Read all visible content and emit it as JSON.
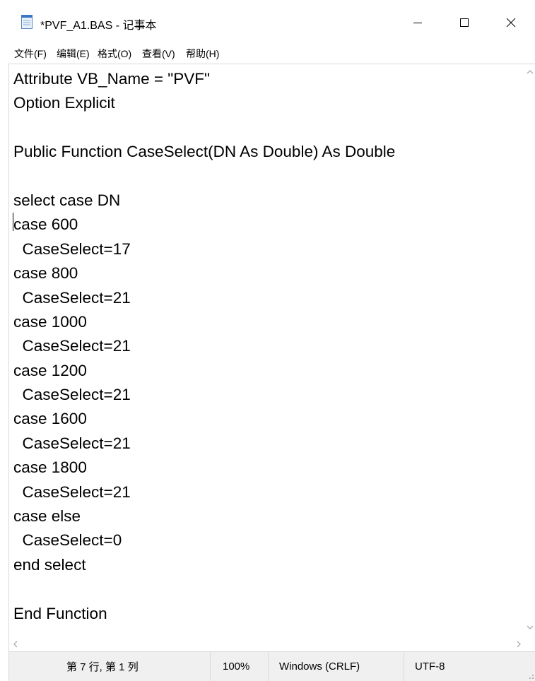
{
  "window": {
    "title": "*PVF_A1.BAS - 记事本",
    "controls": {
      "minimize": "minimize-icon",
      "maximize": "maximize-icon",
      "close": "close-icon"
    }
  },
  "menu": {
    "items": [
      {
        "label": "文件(F)"
      },
      {
        "label": "编辑(E)"
      },
      {
        "label": "格式(O)"
      },
      {
        "label": "查看(V)"
      },
      {
        "label": "帮助(H)"
      }
    ]
  },
  "editor": {
    "lines": [
      "Attribute VB_Name = \"PVF\"",
      "Option Explicit",
      "",
      "Public Function CaseSelect(DN As Double) As Double",
      "",
      "select case DN",
      "case 600",
      "  CaseSelect=17",
      "case 800",
      "  CaseSelect=21",
      "case 1000",
      "  CaseSelect=21",
      "case 1200",
      "  CaseSelect=21",
      "case 1600",
      "  CaseSelect=21",
      "case 1800",
      "  CaseSelect=21",
      "case else",
      "  CaseSelect=0",
      "end select",
      "",
      "End Function"
    ]
  },
  "status": {
    "position": "第 7 行, 第 1 列",
    "zoom": "100%",
    "line_ending": "Windows (CRLF)",
    "encoding": "UTF-8"
  }
}
